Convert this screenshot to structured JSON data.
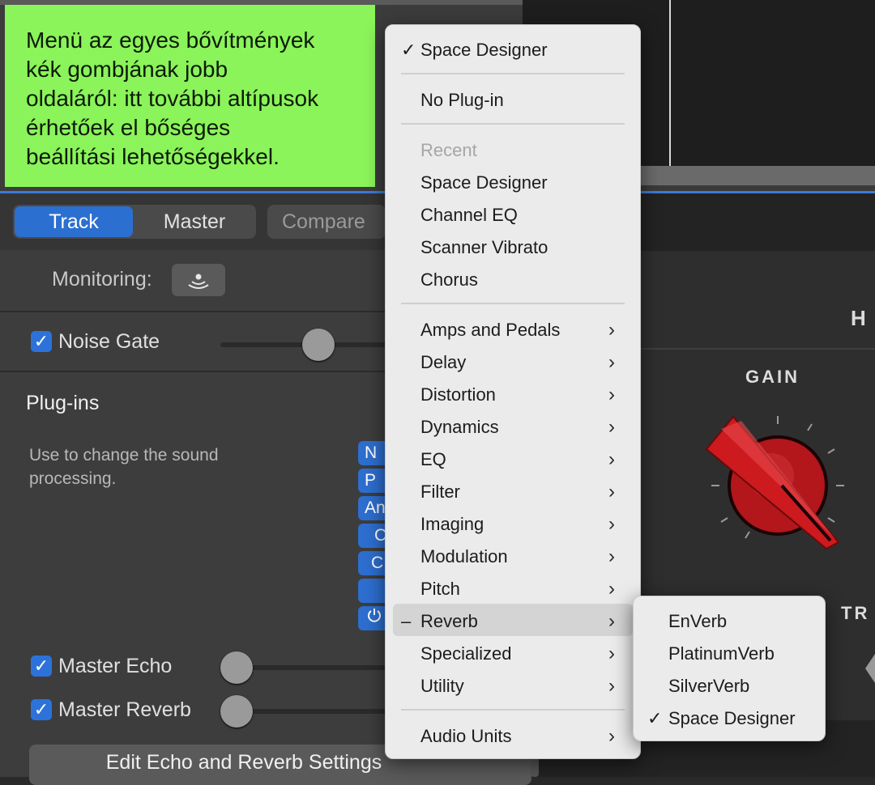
{
  "annotation": {
    "lines": [
      "Menü az egyes bővítmények",
      "kék gombjának jobb",
      "oldaláról: itt további altípusok",
      "érhetőek el bőséges",
      "beállítási lehetőségekkel."
    ]
  },
  "toolbar": {
    "track_label": "Track",
    "master_label": "Master",
    "compare_label": "Compare"
  },
  "monitoring": {
    "label": "Monitoring:"
  },
  "noise_gate": {
    "label": "Noise Gate",
    "checked": true
  },
  "plugins": {
    "title": "Plug-ins",
    "description": "Use to change the sound processing.",
    "slot_labels": [
      "N",
      "P",
      "An",
      "C",
      "C",
      "",
      ""
    ]
  },
  "master_echo": {
    "label": "Master Echo",
    "checked": true
  },
  "master_reverb": {
    "label": "Master Reverb",
    "checked": true
  },
  "edit_button": {
    "label": "Edit Echo and Reverb Settings"
  },
  "amp_panel": {
    "gain_label": "GAIN",
    "h_label": "H",
    "tr_label": "TR"
  },
  "menu": {
    "selected": "Space Designer",
    "no_plugin": "No Plug-in",
    "recent_header": "Recent",
    "recent": [
      "Space Designer",
      "Channel EQ",
      "Scanner Vibrato",
      "Chorus"
    ],
    "categories": [
      "Amps and Pedals",
      "Delay",
      "Distortion",
      "Dynamics",
      "EQ",
      "Filter",
      "Imaging",
      "Modulation",
      "Pitch",
      "Reverb",
      "Specialized",
      "Utility"
    ],
    "highlighted": "Reverb",
    "audio_units": "Audio Units"
  },
  "submenu": {
    "items": [
      "EnVerb",
      "PlatinumVerb",
      "SilverVerb",
      "Space Designer"
    ],
    "checked": "Space Designer"
  },
  "colors": {
    "accent": "#2d72d9",
    "annotation_bg": "#8af45a",
    "knob_red": "#c0161a"
  }
}
